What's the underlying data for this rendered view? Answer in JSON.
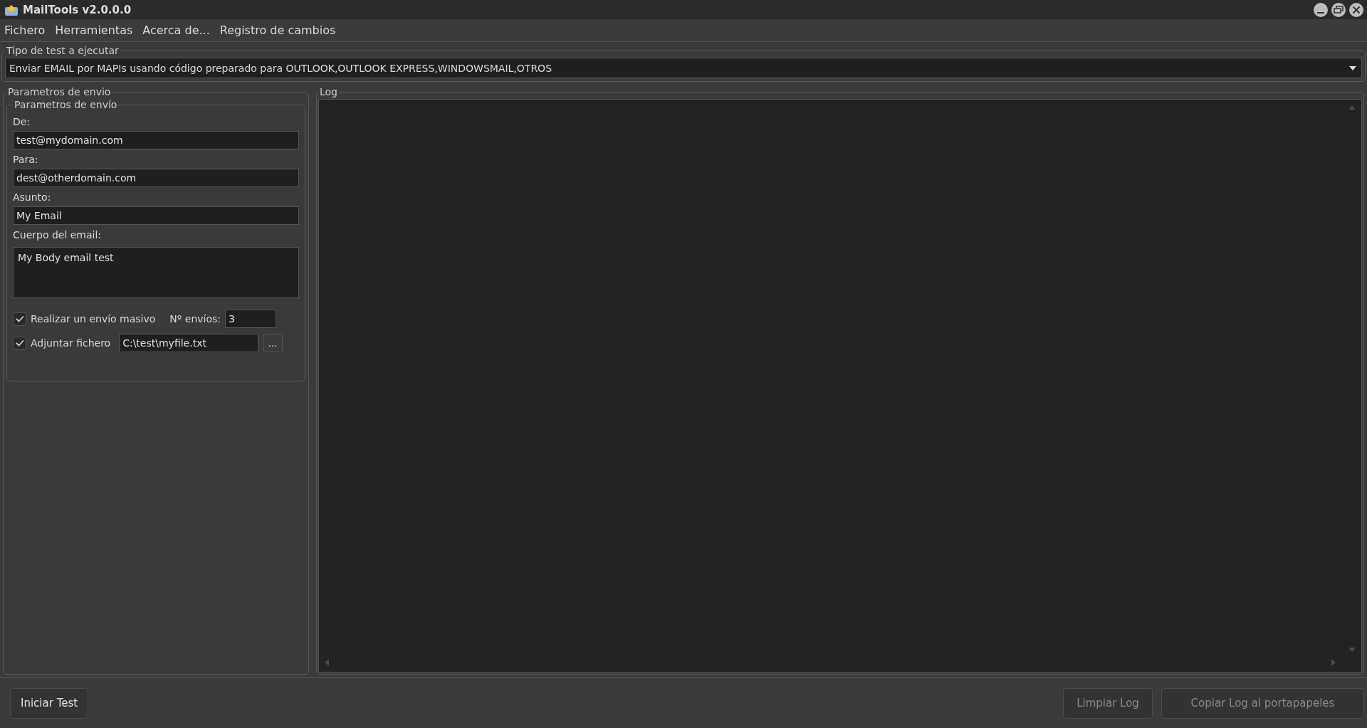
{
  "window": {
    "title": "MailTools v2.0.0.0"
  },
  "menu": [
    "Fichero",
    "Herramientas",
    "Acerca de...",
    "Registro de cambios"
  ],
  "test_type": {
    "legend": "Tipo de test a ejecutar",
    "value": "Enviar EMAIL por MAPIs usando código preparado para OUTLOOK,OUTLOOK EXPRESS,WINDOWSMAIL,OTROS"
  },
  "params": {
    "legend": "Parametros de envio",
    "inner_legend": "Parametros de envío",
    "fields": [
      {
        "label": "De:",
        "value": "test@mydomain.com",
        "kind": "line"
      },
      {
        "label": "Para:",
        "value": "dest@otherdomain.com",
        "kind": "line"
      },
      {
        "label": "Asunto:",
        "value": "My Email",
        "kind": "line"
      },
      {
        "label": "Cuerpo del email:",
        "value": "My Body email test",
        "kind": "area"
      }
    ],
    "bulk": {
      "label": "Realizar un envío masivo",
      "checked": true,
      "count_label": "Nº  envíos:",
      "count": "3"
    },
    "attach": {
      "label": "Adjuntar fichero",
      "checked": true,
      "path": "C:\\test\\myfile.txt",
      "browse": "..."
    }
  },
  "log": {
    "legend": "Log"
  },
  "buttons": [
    {
      "label": "Iniciar Test",
      "disabled": false
    },
    {
      "label": "Limpiar Log",
      "disabled": true
    },
    {
      "label": "Copiar Log al portapapeles",
      "disabled": true
    }
  ]
}
